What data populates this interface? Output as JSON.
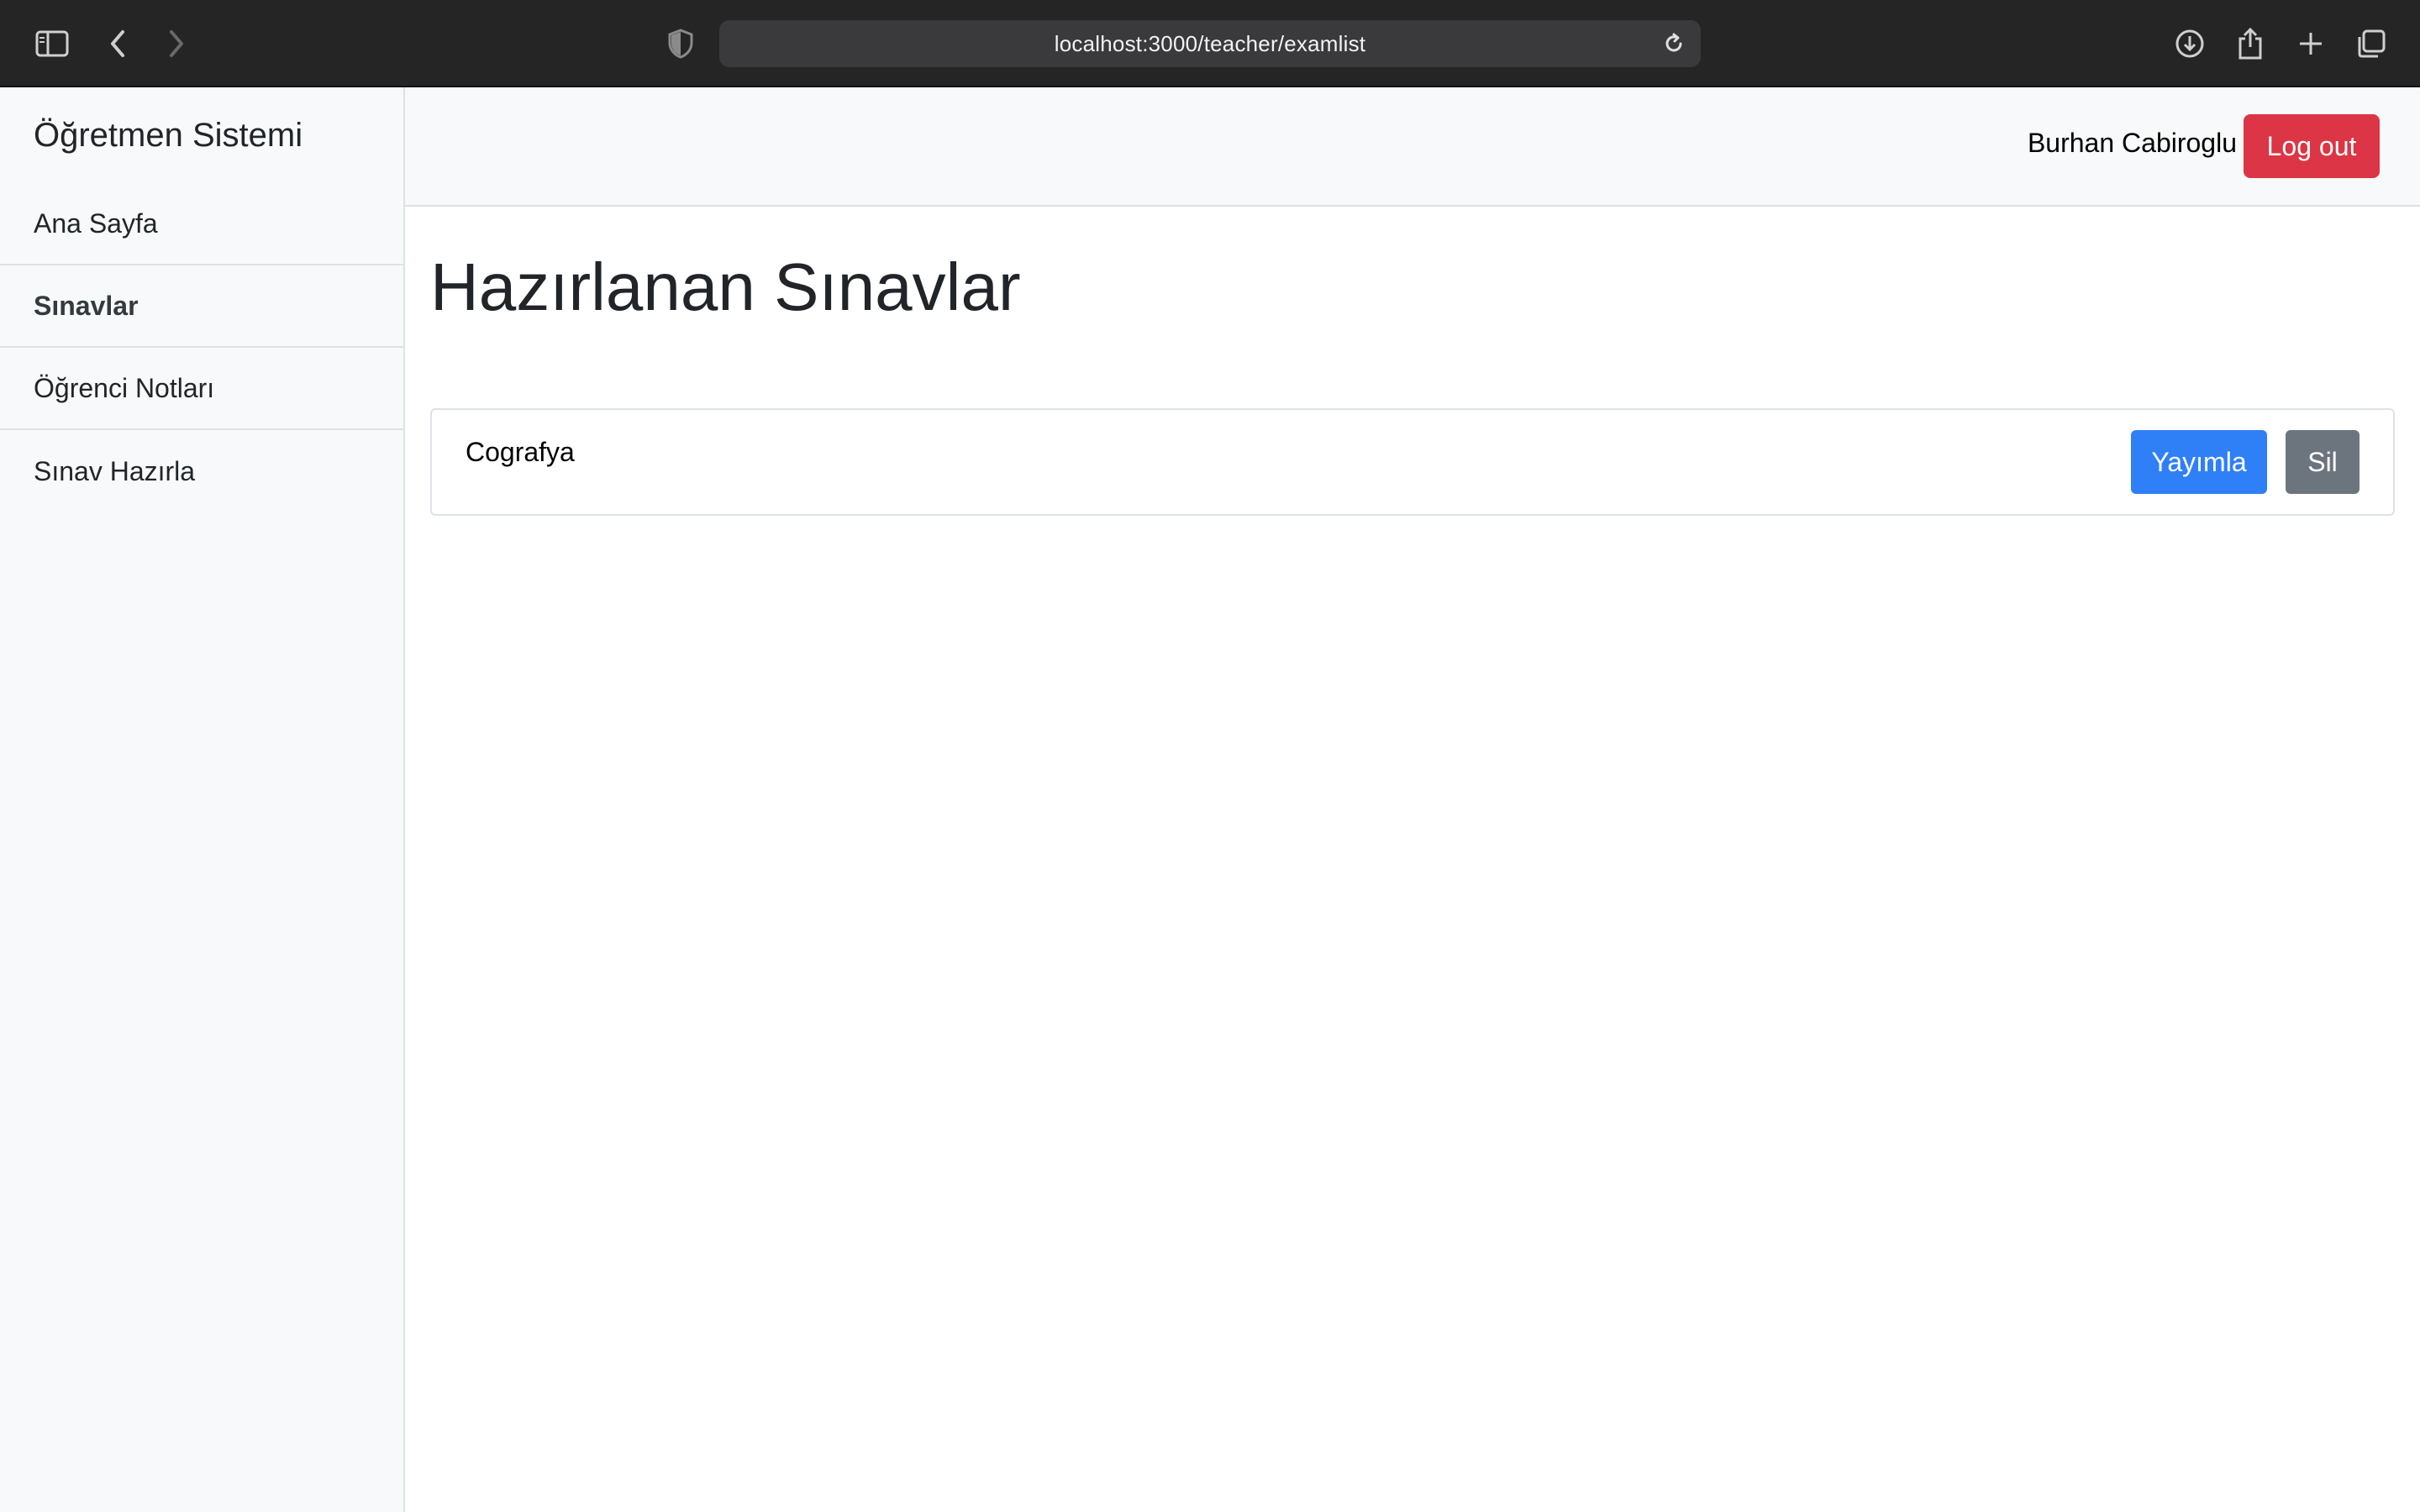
{
  "browser": {
    "url": "localhost:3000/teacher/examlist",
    "icons": [
      "sidebar-toggle-icon",
      "back-icon",
      "forward-icon",
      "shield-icon",
      "reload-icon",
      "download-icon",
      "share-icon",
      "new-tab-icon",
      "tabs-overview-icon"
    ]
  },
  "sidebar": {
    "brand": "Öğretmen Sistemi",
    "items": [
      {
        "label": "Ana Sayfa",
        "active": false
      },
      {
        "label": "Sınavlar",
        "active": true
      },
      {
        "label": "Öğrenci Notları",
        "active": false
      },
      {
        "label": "Sınav Hazırla",
        "active": false
      }
    ]
  },
  "header": {
    "user_name": "Burhan Cabiroglu",
    "logout_label": "Log out"
  },
  "main": {
    "title": "Hazırlanan Sınavlar",
    "exams": [
      {
        "name": "Cografya",
        "publish_label": "Yayımla",
        "delete_label": "Sil"
      }
    ]
  },
  "colors": {
    "danger": "#dc3545",
    "primary": "#2f7ff7",
    "secondary": "#6c757d",
    "sidebar_bg": "#f8f9fa"
  }
}
